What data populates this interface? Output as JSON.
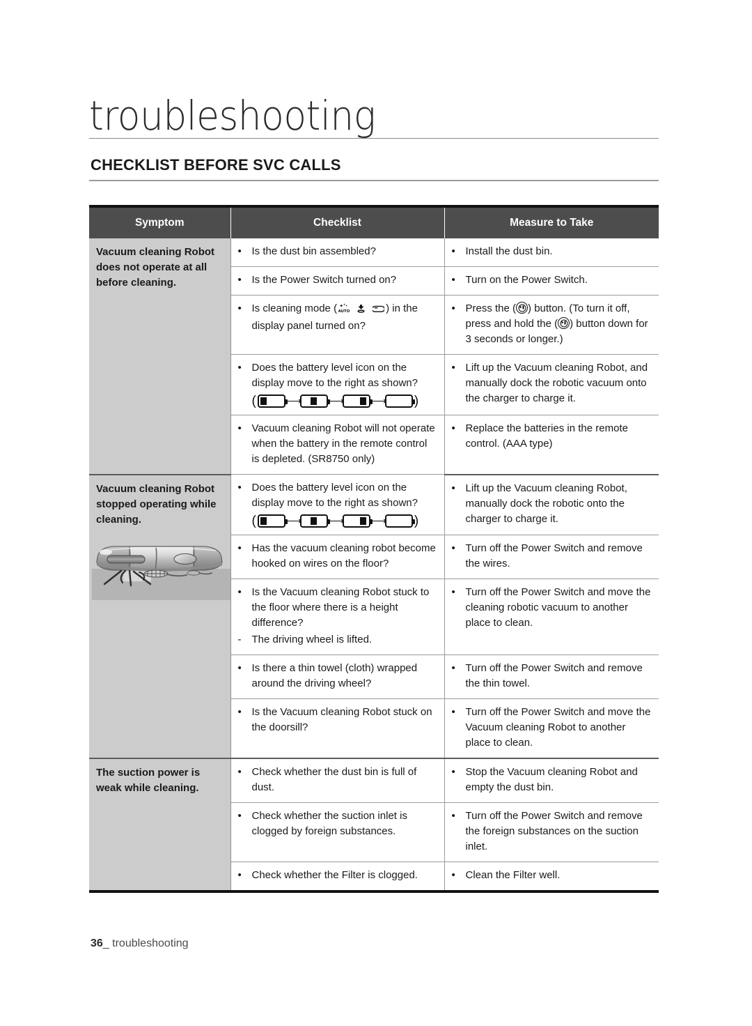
{
  "page": {
    "chapter_title": "troubleshooting",
    "section_title": "CHECKLIST BEFORE SVC CALLS",
    "footer_page_number": "36",
    "footer_separator": "_",
    "footer_label": "troubleshooting",
    "colors": {
      "header_bg": "#4d4d4d",
      "header_text": "#ffffff",
      "symptom_bg": "#cccccc",
      "rule": "#9b9b9b",
      "table_border": "#111111"
    }
  },
  "table": {
    "headers": [
      "Symptom",
      "Checklist",
      "Measure to Take"
    ],
    "groups": [
      {
        "symptom": "Vacuum cleaning Robot does not operate at all before cleaning.",
        "has_image": false,
        "rows": [
          {
            "checklist_bullet": "dot",
            "checklist": "Is the dust bin assembled?",
            "measure_bullet": "dot",
            "measure": "Install the dust bin."
          },
          {
            "checklist_bullet": "dot",
            "checklist": "Is the Power Switch turned on?",
            "measure_bullet": "dot",
            "measure": "Turn on the Power Switch."
          },
          {
            "checklist_bullet": "dot",
            "checklist_pre": "Is cleaning mode (",
            "checklist_post": ") in the display panel turned on?",
            "checklist_icons": [
              "auto-mode-icon",
              "spot-mode-icon",
              "max-mode-icon"
            ],
            "measure_bullet": "dot",
            "measure_pre": "Press the (",
            "measure_mid": ") button. (To turn it off, press and hold the (",
            "measure_post": ") button down for 3 seconds or longer.)",
            "measure_icons": [
              "power-button-icon",
              "power-button-icon"
            ]
          },
          {
            "checklist_bullet": "dot",
            "checklist": "Does the battery level icon on the display move to the right as shown?",
            "checklist_battery": true,
            "measure_bullet": "dot",
            "measure": "Lift up the Vacuum cleaning Robot, and manually dock the robotic vacuum onto the charger to charge it."
          },
          {
            "checklist_bullet": "dot",
            "checklist": "Vacuum cleaning Robot will not operate when the battery in the remote control is depleted. (SR8750 only)",
            "measure_bullet": "dot",
            "measure": "Replace the batteries in the remote control. (AAA type)"
          }
        ]
      },
      {
        "symptom": "Vacuum cleaning Robot stopped operating while cleaning.",
        "has_image": true,
        "image_name": "robot-vacuum-side-view-illustration",
        "rows": [
          {
            "checklist_bullet": "dot",
            "checklist": "Does the battery level icon on the display move to the right as shown?",
            "checklist_battery": true,
            "measure_bullet": "dot",
            "measure": "Lift up the Vacuum cleaning Robot, manually dock the robotic onto the charger to charge it."
          },
          {
            "checklist_bullet": "dot",
            "checklist": "Has the vacuum cleaning robot become hooked on wires on the floor?",
            "measure_bullet": "dot",
            "measure": "Turn off the Power Switch and remove the wires."
          },
          {
            "checklist_bullet": "dot",
            "checklist": "Is the Vacuum cleaning Robot stuck to the floor where there is a height difference?",
            "checklist_sub_bullet": "dash",
            "checklist_sub": "The driving wheel is lifted.",
            "measure_bullet": "dot",
            "measure": "Turn off the Power Switch and move the cleaning robotic vacuum to another place to clean."
          },
          {
            "checklist_bullet": "dot",
            "checklist": "Is there a thin towel (cloth) wrapped around the driving wheel?",
            "measure_bullet": "dot",
            "measure": "Turn off the Power Switch and remove the thin towel."
          },
          {
            "checklist_bullet": "dot",
            "checklist": "Is the Vacuum cleaning Robot stuck on the doorsill?",
            "measure_bullet": "dot",
            "measure": "Turn off the Power Switch and move the Vacuum cleaning Robot to another place to clean."
          }
        ]
      },
      {
        "symptom": "The suction power is weak while cleaning.",
        "has_image": false,
        "rows": [
          {
            "checklist_bullet": "dot",
            "checklist": "Check whether the dust bin is full of dust.",
            "measure_bullet": "dot",
            "measure": "Stop the Vacuum cleaning Robot and empty the dust bin."
          },
          {
            "checklist_bullet": "dot",
            "checklist": "Check whether the suction inlet is clogged by foreign substances.",
            "measure_bullet": "dot",
            "measure": "Turn off the Power Switch and remove the foreign substances on the suction inlet."
          },
          {
            "checklist_bullet": "dot",
            "checklist": "Check whether the Filter is clogged.",
            "measure_bullet": "dot",
            "measure": "Clean the Filter well."
          }
        ]
      }
    ]
  }
}
